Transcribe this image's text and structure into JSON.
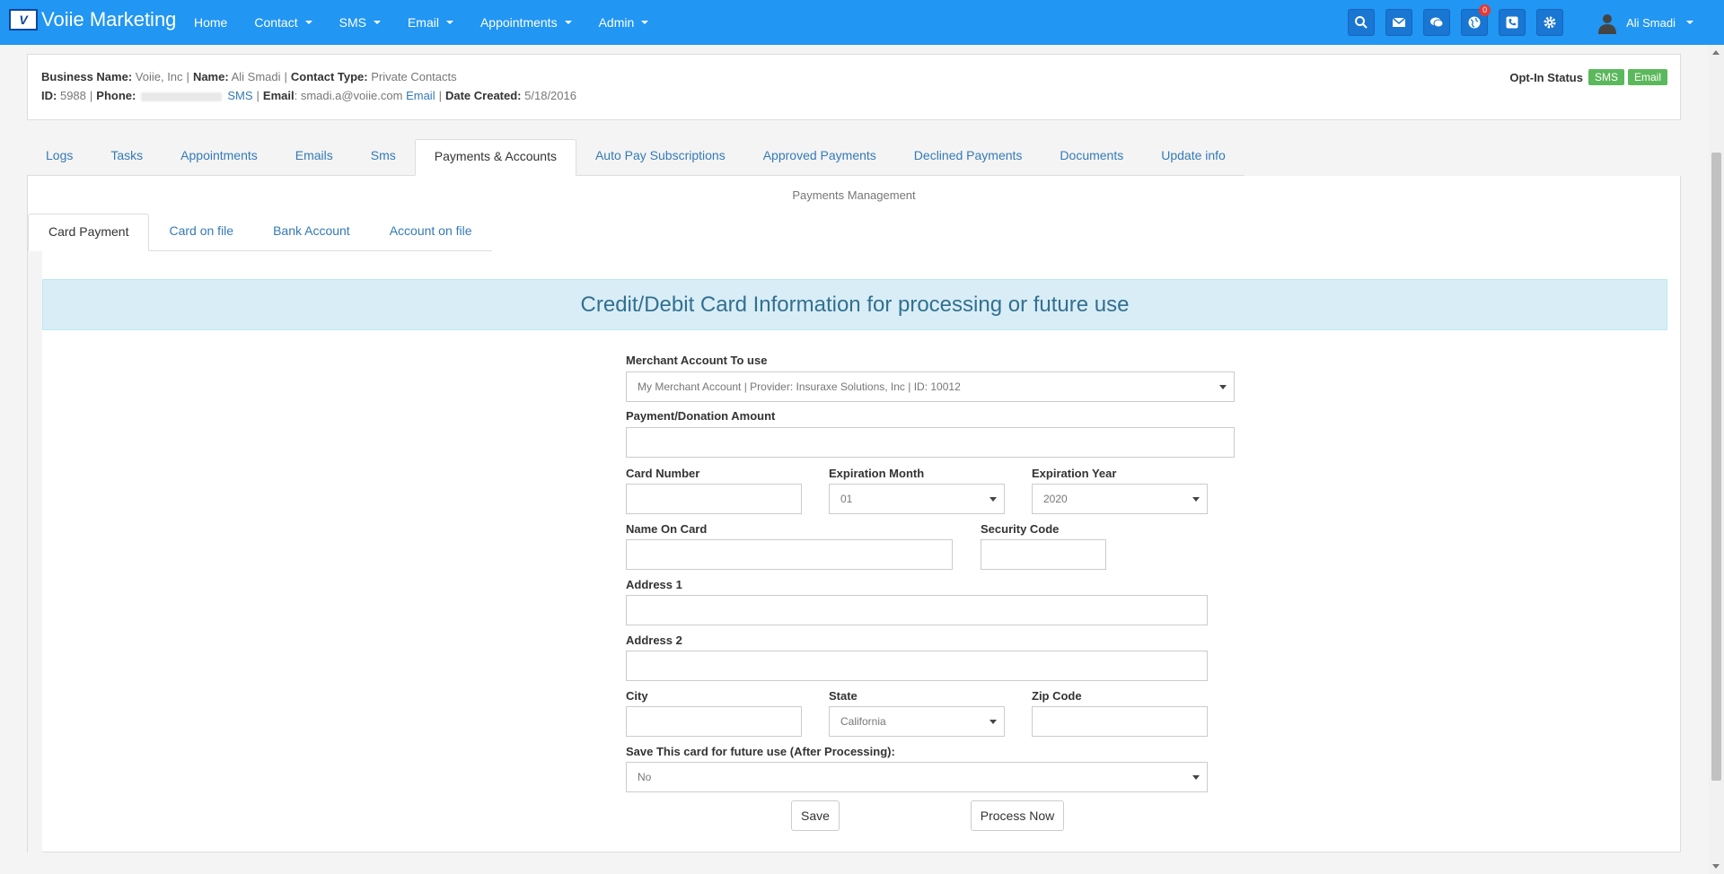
{
  "navbar": {
    "brand": "Voiie Marketing",
    "logo_text": "V",
    "items": [
      {
        "label": "Home",
        "dropdown": false
      },
      {
        "label": "Contact",
        "dropdown": true
      },
      {
        "label": "SMS",
        "dropdown": true
      },
      {
        "label": "Email",
        "dropdown": true
      },
      {
        "label": "Appointments",
        "dropdown": true
      },
      {
        "label": "Admin",
        "dropdown": true
      }
    ],
    "notification_count": "0",
    "user_name": "Ali Smadi"
  },
  "contact": {
    "business_name_label": "Business Name:",
    "business_name": "Voiie, Inc",
    "name_label": "Name:",
    "name": "Ali Smadi",
    "contact_type_label": "Contact Type:",
    "contact_type": "Private Contacts",
    "id_label": "ID:",
    "id": "5988",
    "phone_label": "Phone:",
    "phone_sms_link": "SMS",
    "email_label": "Email",
    "email": "smadi.a@voiie.com",
    "email_link": "Email",
    "date_created_label": "Date Created:",
    "date_created": "5/18/2016",
    "optin_label": "Opt-In Status",
    "optin_sms": "SMS",
    "optin_email": "Email"
  },
  "main_tabs": [
    "Logs",
    "Tasks",
    "Appointments",
    "Emails",
    "Sms",
    "Payments & Accounts",
    "Auto Pay Subscriptions",
    "Approved Payments",
    "Declined Payments",
    "Documents",
    "Update info"
  ],
  "panel_title": "Payments Management",
  "sub_tabs": [
    "Card Payment",
    "Card on file",
    "Bank Account",
    "Account on file"
  ],
  "banner": "Credit/Debit Card Information for processing or future use",
  "form": {
    "merchant_label": "Merchant Account To use",
    "merchant_value": "My Merchant Account | Provider: Insuraxe Solutions, Inc | ID: 10012",
    "amount_label": "Payment/Donation Amount",
    "card_number_label": "Card Number",
    "exp_month_label": "Expiration Month",
    "exp_month_value": "01",
    "exp_year_label": "Expiration Year",
    "exp_year_value": "2020",
    "name_on_card_label": "Name On Card",
    "security_code_label": "Security Code",
    "address1_label": "Address 1",
    "address2_label": "Address 2",
    "city_label": "City",
    "state_label": "State",
    "state_value": "California",
    "zip_label": "Zip Code",
    "save_card_label": "Save This card for future use (After Processing):",
    "save_card_value": "No",
    "save_button": "Save",
    "process_button": "Process Now"
  },
  "colors": {
    "navbar": "#2196f3",
    "link": "#337ab7",
    "optin_badge": "#5cb85c",
    "banner_bg": "#d9edf7",
    "banner_text": "#31708f"
  }
}
